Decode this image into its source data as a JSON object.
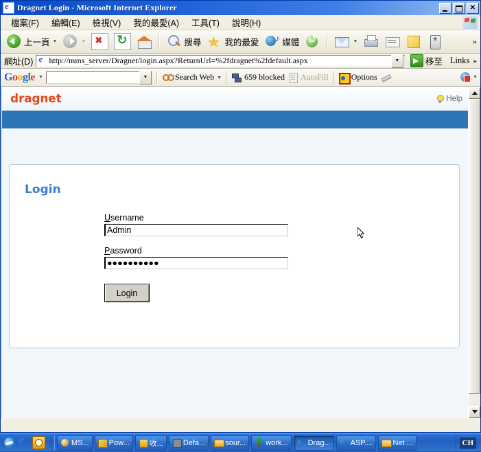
{
  "window": {
    "title": "Dragnet Login - Microsoft Internet Explorer",
    "minimize_label": "",
    "maximize_label": "",
    "close_label": "✕"
  },
  "menu": {
    "items": [
      {
        "label": "檔案(F)",
        "name": "menu-file"
      },
      {
        "label": "編輯(E)",
        "name": "menu-edit"
      },
      {
        "label": "檢視(V)",
        "name": "menu-view"
      },
      {
        "label": "我的最愛(A)",
        "name": "menu-favorites"
      },
      {
        "label": "工具(T)",
        "name": "menu-tools"
      },
      {
        "label": "說明(H)",
        "name": "menu-help"
      }
    ]
  },
  "toolbar": {
    "back_label": "上一頁",
    "forward_label": "",
    "search_label": "搜尋",
    "favorites_label": "我的最愛",
    "media_label": "媒體",
    "overflow_label": "»",
    "icons": {
      "back": "back-arrow-icon",
      "forward": "forward-arrow-icon",
      "stop": "stop-icon",
      "refresh": "refresh-icon",
      "home": "home-icon",
      "search": "search-icon",
      "favorites": "star-icon",
      "media": "media-icon",
      "history": "history-icon",
      "mail": "mail-icon",
      "print": "print-icon",
      "edit": "edit-icon",
      "notes": "notes-icon",
      "messenger": "messenger-icon"
    }
  },
  "address": {
    "label": "網址(D)",
    "url": "http://mms_server/Dragnet/login.aspx?ReturnUrl=%2fdragnet%2fdefault.aspx",
    "go_label": "移至",
    "links_label": "Links",
    "links_chevron": "»"
  },
  "google_toolbar": {
    "logo": {
      "g1": "G",
      "o1": "o",
      "o2": "o",
      "g2": "g",
      "l": "l",
      "e": "e"
    },
    "search_value": "",
    "search_web_label": "Search Web",
    "blocked_label": "659 blocked",
    "autofill_label": "AutoFill",
    "options_label": "Options"
  },
  "page": {
    "brand": "dragnet",
    "help_label": "Help",
    "panel": {
      "title": "Login",
      "username_label_first": "U",
      "username_label_rest": "sername",
      "username_value": "Admin",
      "password_label_first": "P",
      "password_label_rest": "assword",
      "password_value": "●●●●●●●●●●",
      "submit_label": "Login"
    }
  },
  "scrollbar": {
    "up_label": "",
    "down_label": ""
  },
  "taskbar": {
    "quick_launch": [
      {
        "name": "show-desktop-icon",
        "label": ""
      },
      {
        "name": "internet-explorer-icon",
        "label": ""
      },
      {
        "name": "clock-icon",
        "label": ""
      }
    ],
    "tasks": [
      {
        "label": "MS...",
        "icon": "msn-icon",
        "active": false
      },
      {
        "label": "Pow...",
        "icon": "powerpoint-icon",
        "active": false
      },
      {
        "label": "收...",
        "icon": "clock-icon",
        "active": false
      },
      {
        "label": "Defa...",
        "icon": "app-icon",
        "active": false
      },
      {
        "label": "sour...",
        "icon": "folder-icon",
        "active": false
      },
      {
        "label": "work...",
        "icon": "tree-icon",
        "active": false
      },
      {
        "label": "Drag...",
        "icon": "ie-icon",
        "active": true
      },
      {
        "label": "ASP....",
        "icon": "ie-icon",
        "active": false
      },
      {
        "label": "Net ...",
        "icon": "folder-icon",
        "active": false
      }
    ],
    "language_indicator": "CH"
  }
}
